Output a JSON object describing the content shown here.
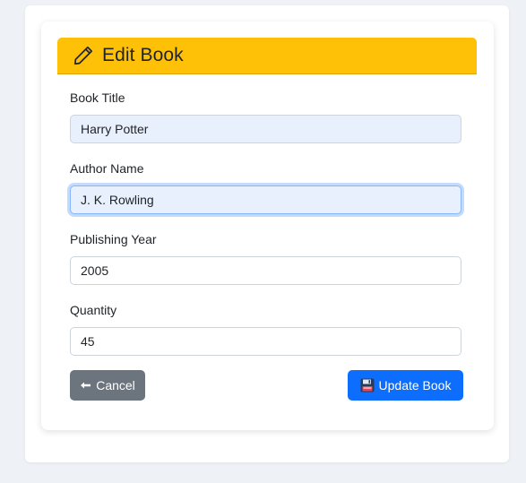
{
  "form": {
    "title": "Edit Book",
    "title_icon": "pencil-icon",
    "fields": [
      {
        "label": "Book Title",
        "value": "Harry Potter"
      },
      {
        "label": "Author Name",
        "value": "J. K. Rowling"
      },
      {
        "label": "Publishing Year",
        "value": "2005"
      },
      {
        "label": "Quantity",
        "value": "45"
      }
    ],
    "cancel_label": "Cancel",
    "cancel_icon": "arrow-left-icon",
    "update_label": "Update Book",
    "update_icon": "floppy-disk-icon"
  },
  "colors": {
    "header_bg": "#ffc107",
    "cancel_bg": "#6c757d",
    "update_bg": "#0d6efd",
    "autofill_bg": "#e8f0fe",
    "page_bg": "#eef1f6"
  }
}
